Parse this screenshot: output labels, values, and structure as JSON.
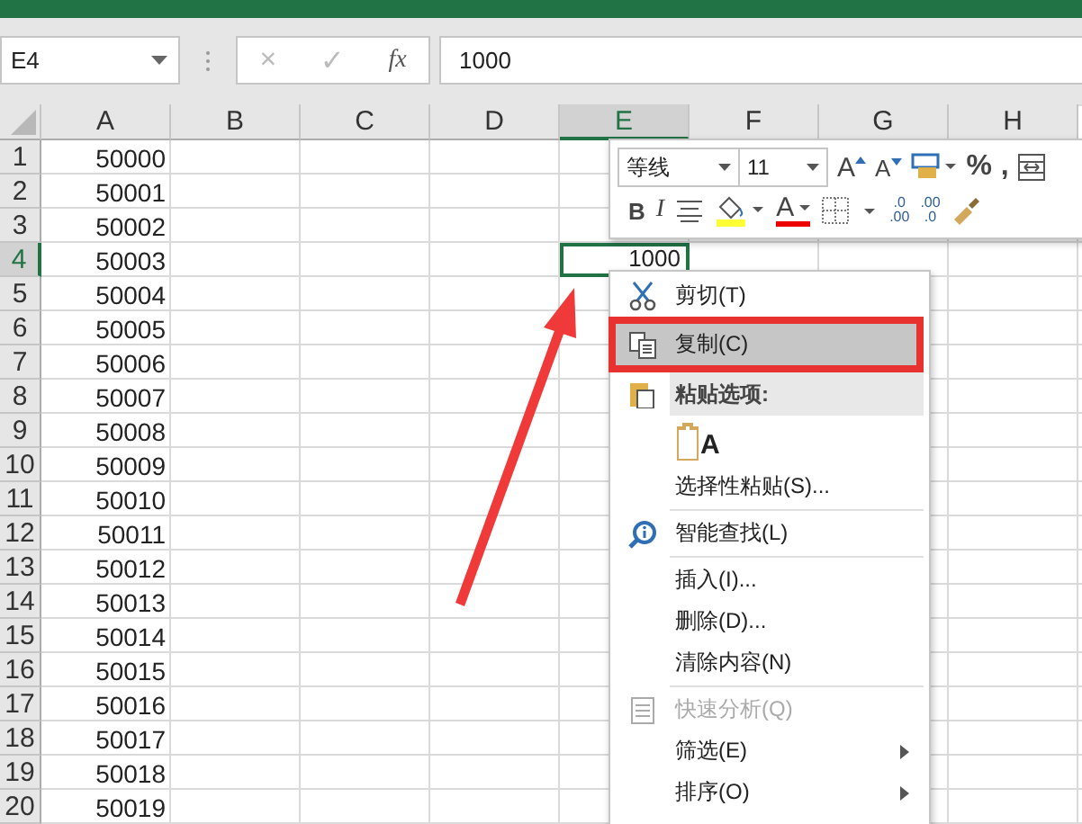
{
  "name_box": {
    "value": "E4"
  },
  "formula_bar": {
    "cancel": "×",
    "enter": "✓",
    "fx": "fx",
    "value": "1000"
  },
  "columns": [
    {
      "label": "A",
      "selected": false
    },
    {
      "label": "B",
      "selected": false
    },
    {
      "label": "C",
      "selected": false
    },
    {
      "label": "D",
      "selected": false
    },
    {
      "label": "E",
      "selected": true
    },
    {
      "label": "F",
      "selected": false
    },
    {
      "label": "G",
      "selected": false
    },
    {
      "label": "H",
      "selected": false
    }
  ],
  "rows": [
    {
      "header": "1",
      "selected": false,
      "a": "50000"
    },
    {
      "header": "2",
      "selected": false,
      "a": "50001"
    },
    {
      "header": "3",
      "selected": false,
      "a": "50002"
    },
    {
      "header": "4",
      "selected": true,
      "a": "50003",
      "e": {
        "text": "1000",
        "active": true
      }
    },
    {
      "header": "5",
      "selected": false,
      "a": "50004"
    },
    {
      "header": "6",
      "selected": false,
      "a": "50005"
    },
    {
      "header": "7",
      "selected": false,
      "a": "50006"
    },
    {
      "header": "8",
      "selected": false,
      "a": "50007"
    },
    {
      "header": "9",
      "selected": false,
      "a": "50008"
    },
    {
      "header": "10",
      "selected": false,
      "a": "50009"
    },
    {
      "header": "11",
      "selected": false,
      "a": "50010"
    },
    {
      "header": "12",
      "selected": false,
      "a": "50011"
    },
    {
      "header": "13",
      "selected": false,
      "a": "50012"
    },
    {
      "header": "14",
      "selected": false,
      "a": "50013"
    },
    {
      "header": "15",
      "selected": false,
      "a": "50014"
    },
    {
      "header": "16",
      "selected": false,
      "a": "50015"
    },
    {
      "header": "17",
      "selected": false,
      "a": "50016"
    },
    {
      "header": "18",
      "selected": false,
      "a": "50017"
    },
    {
      "header": "19",
      "selected": false,
      "a": "50018"
    },
    {
      "header": "20",
      "selected": false,
      "a": "50019"
    }
  ],
  "mini_toolbar": {
    "font_name": "等线",
    "font_size": "11",
    "top_row": [
      {
        "kind": "grow",
        "label": "A"
      },
      {
        "kind": "shrink",
        "label": "A"
      },
      {
        "kind": "wrap"
      },
      {
        "kind": "text",
        "label": "%"
      },
      {
        "kind": "text",
        "label": ","
      },
      {
        "kind": "merge"
      }
    ],
    "bottom_row": [
      {
        "kind": "bold",
        "label": "B"
      },
      {
        "kind": "italic",
        "label": "I"
      },
      {
        "kind": "align"
      },
      {
        "kind": "fill"
      },
      {
        "kind": "fontcolor",
        "label": "A"
      },
      {
        "kind": "border"
      },
      {
        "kind": "decimal",
        "label": ".0",
        "label2": ".00"
      },
      {
        "kind": "decimal",
        "label": ".00",
        "label2": ".0"
      },
      {
        "kind": "painter"
      }
    ]
  },
  "context_menu": [
    {
      "kind": "cut",
      "label": "剪切(T)",
      "selected": false,
      "disabled": false
    },
    {
      "kind": "copy",
      "label": "复制(C)",
      "selected": true,
      "disabled": false
    },
    {
      "kind": "header",
      "label": "粘贴选项:"
    },
    {
      "kind": "paste",
      "label": "A",
      "selected": false,
      "disabled": false
    },
    {
      "kind": "item",
      "label": "选择性粘贴(S)...",
      "selected": false,
      "disabled": false
    },
    {
      "kind": "separator"
    },
    {
      "kind": "lookup",
      "label": "智能查找(L)",
      "selected": false,
      "disabled": false
    },
    {
      "kind": "separator"
    },
    {
      "kind": "item",
      "label": "插入(I)...",
      "selected": false,
      "disabled": false
    },
    {
      "kind": "item",
      "label": "删除(D)...",
      "selected": false,
      "disabled": false
    },
    {
      "kind": "item",
      "label": "清除内容(N)",
      "selected": false,
      "disabled": false
    },
    {
      "kind": "separator"
    },
    {
      "kind": "analysis",
      "label": "快速分析(Q)",
      "selected": false,
      "disabled": true
    },
    {
      "kind": "submenu",
      "label": "筛选(E)",
      "selected": false,
      "disabled": false
    },
    {
      "kind": "submenu",
      "label": "排序(O)",
      "selected": false,
      "disabled": false
    }
  ]
}
